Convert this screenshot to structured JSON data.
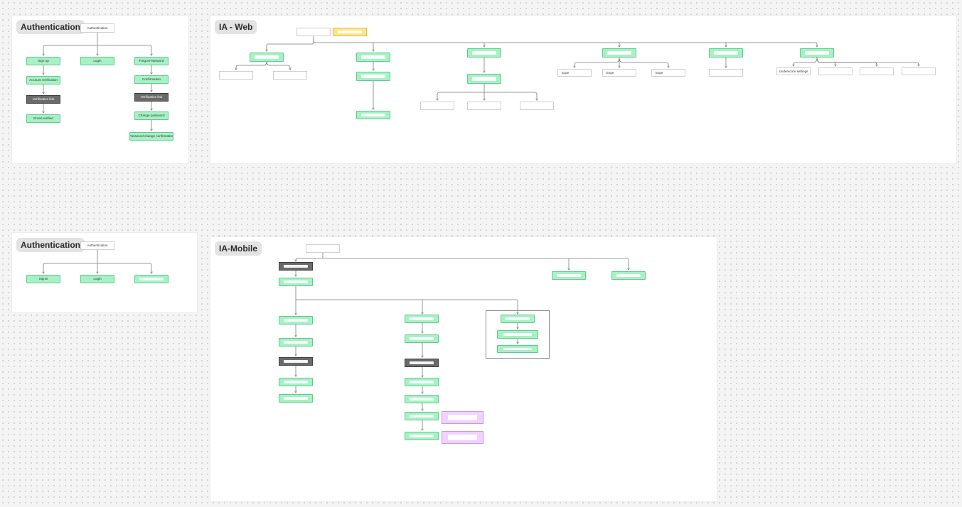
{
  "sections": {
    "auth_web": {
      "title": "Authentication",
      "root": "Authentication"
    },
    "ia_web": {
      "title": "IA - Web"
    },
    "auth_mobile": {
      "title": "Authentication",
      "root": "Authentication"
    },
    "ia_mobile": {
      "title": "IA-Mobile"
    }
  },
  "auth_web_nodes": {
    "signup": "Sign up",
    "account_verification": "Account verification",
    "verification_link": "Verification link",
    "email_verified": "Email verified",
    "login": "Login",
    "forgot_password": "Forgot Password",
    "confirmation": "Confirmation",
    "verification_link_2": "Verification link",
    "change_password": "Change password",
    "password_change_confirmation": "Password change confirmation"
  },
  "auth_mobile_nodes": {
    "signup": "Signin",
    "login": "Login"
  },
  "ia_web_nodes": {
    "root": "",
    "e1": "Expe",
    "e2": "Expe",
    "e3": "Expe",
    "settings": "Underscore settings"
  },
  "colors": {
    "green": "#a8f0c5",
    "dark": "#6a6a6a",
    "yellow": "#ffe48a",
    "purple": "#efd2ff"
  }
}
